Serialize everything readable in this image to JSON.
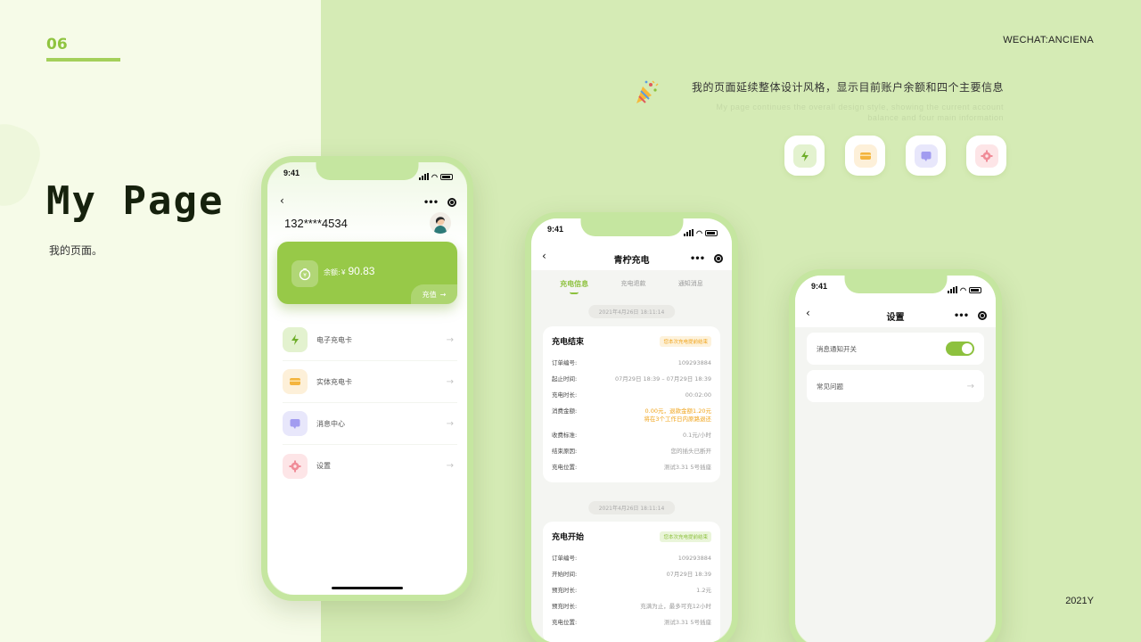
{
  "slide": {
    "page_number": "06",
    "title": "My Page",
    "subtitle": "我的页面。",
    "wechat": "WECHAT:ANCIENA",
    "year": "2021Y",
    "description_cn": "我的页面延续整体设计风格，显示目前账户余额和四个主要信息",
    "description_en": "My page continues the overall design style, showing the current account balance and four main information",
    "feature_icons": [
      "charge-card-icon",
      "physical-card-icon",
      "message-icon",
      "settings-icon"
    ]
  },
  "colors": {
    "accent": "#97c948",
    "background": "#d5ebb5",
    "left_panel": "#f6fbe8",
    "warning": "#f0a41b"
  },
  "phone_mypage": {
    "time": "9:41",
    "phone_number": "132****4534",
    "balance_label": "余额:",
    "currency": "¥",
    "balance": "90.83",
    "recharge_label": "充值",
    "menu": [
      {
        "label": "电子充电卡",
        "icon": "charge-card-icon"
      },
      {
        "label": "实体充电卡",
        "icon": "physical-card-icon"
      },
      {
        "label": "消息中心",
        "icon": "message-icon"
      },
      {
        "label": "设置",
        "icon": "settings-icon"
      }
    ]
  },
  "phone_records": {
    "time": "9:41",
    "title": "青柠充电",
    "tabs": [
      "充电信息",
      "充电退款",
      "通知消息"
    ],
    "active_tab": 0,
    "records": [
      {
        "date": "2021年4月26日 18:11:14",
        "title": "充电结束",
        "badge": "您本次充电提前结束",
        "rows": [
          {
            "k": "订单编号:",
            "v": "109293884"
          },
          {
            "k": "起止时间:",
            "v": "07月29日 18:39 – 07月29日 18:39"
          },
          {
            "k": "充电时长:",
            "v": "00:02:00"
          },
          {
            "k": "消费金额:",
            "v": "0.00元，退款金额1.20元",
            "v2": "将在3个工作日内原路退还",
            "highlight": true
          },
          {
            "k": "收费标准:",
            "v": "0.1元/小时"
          },
          {
            "k": "结束原因:",
            "v": "您的插头已断开"
          },
          {
            "k": "充电位置:",
            "v": "测试3.31 5号插座"
          }
        ]
      },
      {
        "date": "2021年4月26日 18:11:14",
        "title": "充电开始",
        "badge": "您本次充电提前结束",
        "rows": [
          {
            "k": "订单编号:",
            "v": "109293884"
          },
          {
            "k": "开始时间:",
            "v": "07月29日 18:39"
          },
          {
            "k": "预充时长:",
            "v": "1.2元"
          },
          {
            "k": "预充时长:",
            "v": "充满为止，最多可充12小时"
          },
          {
            "k": "充电位置:",
            "v": "测试3.31 5号插座"
          }
        ]
      }
    ]
  },
  "phone_settings": {
    "time": "9:41",
    "title": "设置",
    "notification_label": "消息通知开关",
    "notification_on": true,
    "faq_label": "常见问题"
  }
}
